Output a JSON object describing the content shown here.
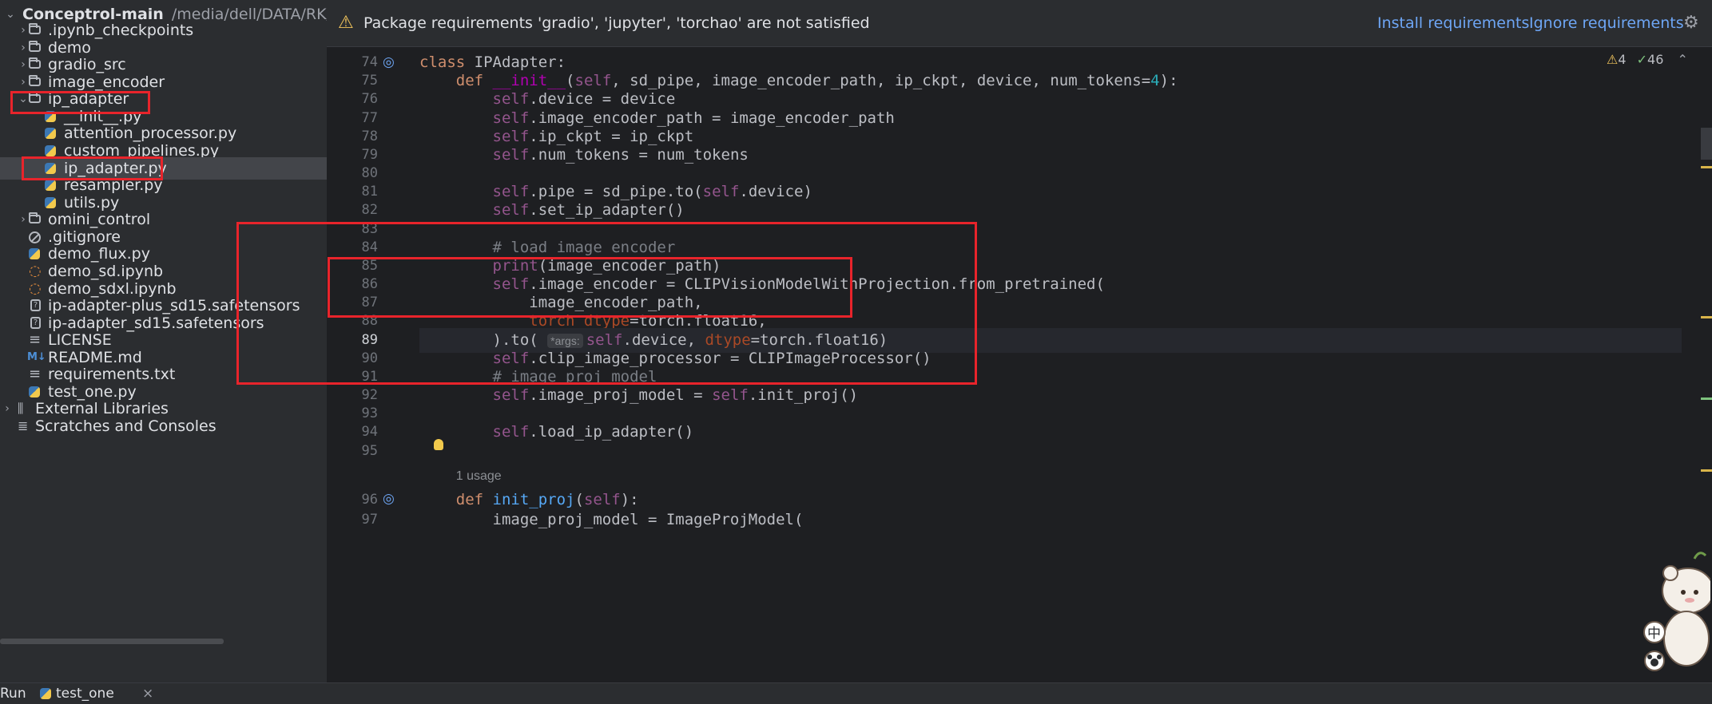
{
  "project": {
    "root_name": "Conceptrol-main",
    "root_path": "/media/dell/DATA/RK/C",
    "items": [
      {
        "label": "Conceptrol-main",
        "kind": "root"
      },
      {
        "label": ".ipynb_checkpoints",
        "kind": "folder"
      },
      {
        "label": "demo",
        "kind": "folder"
      },
      {
        "label": "gradio_src",
        "kind": "folder"
      },
      {
        "label": "image_encoder",
        "kind": "folder"
      },
      {
        "label": "ip_adapter",
        "kind": "folder-open"
      },
      {
        "label": "__init__.py",
        "kind": "python"
      },
      {
        "label": "attention_processor.py",
        "kind": "python"
      },
      {
        "label": "custom_pipelines.py",
        "kind": "python"
      },
      {
        "label": "ip_adapter.py",
        "kind": "python"
      },
      {
        "label": "resampler.py",
        "kind": "python"
      },
      {
        "label": "utils.py",
        "kind": "python"
      },
      {
        "label": "omini_control",
        "kind": "folder"
      },
      {
        "label": ".gitignore",
        "kind": "gitignore"
      },
      {
        "label": "demo_flux.py",
        "kind": "python"
      },
      {
        "label": "demo_sd.ipynb",
        "kind": "notebook"
      },
      {
        "label": "demo_sdxl.ipynb",
        "kind": "notebook"
      },
      {
        "label": "ip-adapter-plus_sd15.safetensors",
        "kind": "binary"
      },
      {
        "label": "ip-adapter_sd15.safetensors",
        "kind": "binary"
      },
      {
        "label": "LICENSE",
        "kind": "text"
      },
      {
        "label": "README.md",
        "kind": "markdown"
      },
      {
        "label": "requirements.txt",
        "kind": "text"
      },
      {
        "label": "test_one.py",
        "kind": "python"
      },
      {
        "label": "External Libraries",
        "kind": "library"
      },
      {
        "label": "Scratches and Consoles",
        "kind": "console"
      }
    ],
    "selected": "ip_adapter.py"
  },
  "banner": {
    "message": "Package requirements 'gradio', 'jupyter', 'torchao' are not satisfied",
    "install": "Install requirements",
    "ignore": "Ignore requirements"
  },
  "inspections": {
    "warnings": "4",
    "typos": "46"
  },
  "editor": {
    "current_line": "89",
    "usage_96": "1 usage",
    "lines": [
      {
        "n": "74",
        "text": "class IPAdapter:"
      },
      {
        "n": "75",
        "text": "    def __init__(self, sd_pipe, image_encoder_path, ip_ckpt, device, num_tokens=4):"
      },
      {
        "n": "76",
        "text": "        self.device = device"
      },
      {
        "n": "77",
        "text": "        self.image_encoder_path = image_encoder_path"
      },
      {
        "n": "78",
        "text": "        self.ip_ckpt = ip_ckpt"
      },
      {
        "n": "79",
        "text": "        self.num_tokens = num_tokens"
      },
      {
        "n": "80",
        "text": ""
      },
      {
        "n": "81",
        "text": "        self.pipe = sd_pipe.to(self.device)"
      },
      {
        "n": "82",
        "text": "        self.set_ip_adapter()"
      },
      {
        "n": "83",
        "text": ""
      },
      {
        "n": "84",
        "text": "        # load image encoder"
      },
      {
        "n": "85",
        "text": "        print(image_encoder_path)"
      },
      {
        "n": "86",
        "text": "        self.image_encoder = CLIPVisionModelWithProjection.from_pretrained("
      },
      {
        "n": "87",
        "text": "            image_encoder_path,"
      },
      {
        "n": "88",
        "text": "            torch_dtype=torch.float16,"
      },
      {
        "n": "89",
        "text": "        ).to( *args: self.device, dtype=torch.float16)"
      },
      {
        "n": "90",
        "text": "        self.clip_image_processor = CLIPImageProcessor()"
      },
      {
        "n": "91",
        "text": "        # image proj model"
      },
      {
        "n": "92",
        "text": "        self.image_proj_model = self.init_proj()"
      },
      {
        "n": "93",
        "text": ""
      },
      {
        "n": "94",
        "text": "        self.load_ip_adapter()"
      },
      {
        "n": "95",
        "text": ""
      },
      {
        "n": "96",
        "text": "    def init_proj(self):"
      },
      {
        "n": "97",
        "text": "        image_proj_model = ImageProjModel("
      }
    ],
    "hint_args": "*args:",
    "ime": "中"
  },
  "bottom": {
    "run": "Run",
    "tab": "test_one",
    "close": "×"
  },
  "colors": {
    "highlight": "#e8242b",
    "keyword": "#cf8e6d",
    "self": "#94558d",
    "function": "#56a8f5",
    "number": "#2aacb8",
    "comment": "#7a7e85",
    "link": "#6ea6f5"
  }
}
